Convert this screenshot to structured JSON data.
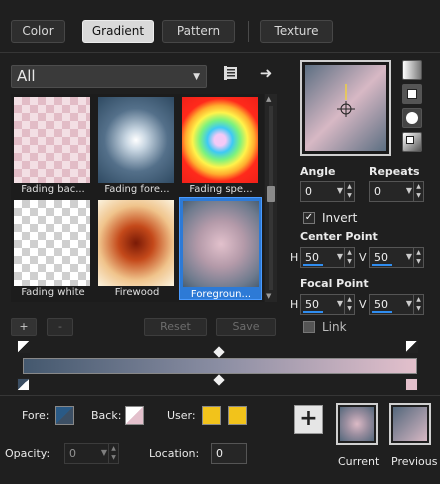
{
  "tabs": [
    {
      "label": "Color",
      "active": false
    },
    {
      "label": "Gradient",
      "active": true
    },
    {
      "label": "Pattern",
      "active": false
    },
    {
      "label": "Texture",
      "active": false
    }
  ],
  "category": {
    "selected": "All"
  },
  "icons": {
    "library": "library-icon",
    "forward": "arrow-right-icon"
  },
  "gradients": [
    {
      "name": "Fading bac...",
      "selected": false
    },
    {
      "name": "Fading fore...",
      "selected": false
    },
    {
      "name": "Fading spe...",
      "selected": false
    },
    {
      "name": "Fading white",
      "selected": false
    },
    {
      "name": "Firewood",
      "selected": false
    },
    {
      "name": "Foregroun...",
      "selected": true
    }
  ],
  "buttons": {
    "add": "+",
    "remove": "-",
    "reset": "Reset",
    "save": "Save"
  },
  "angle": {
    "label": "Angle",
    "value": "0"
  },
  "repeats": {
    "label": "Repeats",
    "value": "0"
  },
  "invert": {
    "label": "Invert",
    "checked": true
  },
  "center_point": {
    "label": "Center Point",
    "h_label": "H",
    "h": "50",
    "v_label": "V",
    "v": "50"
  },
  "focal_point": {
    "label": "Focal Point",
    "h_label": "H",
    "h": "50",
    "v_label": "V",
    "v": "50"
  },
  "link": {
    "label": "Link",
    "checked": false
  },
  "colors_row": {
    "fore_label": "Fore:",
    "back_label": "Back:",
    "user_label": "User:",
    "user_color": "#f2c31b"
  },
  "opacity": {
    "label": "Opacity:",
    "value": "0"
  },
  "location": {
    "label": "Location:",
    "value": "0"
  },
  "current_label": "Current",
  "previous_label": "Previous",
  "accent": "#2f8df0"
}
